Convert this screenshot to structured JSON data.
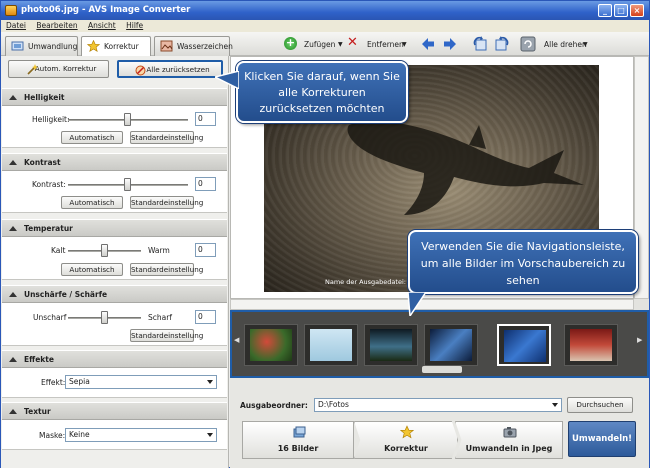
{
  "window": {
    "title": "photo06.jpg - AVS Image Converter"
  },
  "menu": [
    "Datei",
    "Bearbeiten",
    "Ansicht",
    "Hilfe"
  ],
  "tabs": [
    {
      "label": "Umwandlung",
      "active": false
    },
    {
      "label": "Korrektur",
      "active": true
    },
    {
      "label": "Wasserzeichen",
      "active": false
    }
  ],
  "toolbar": {
    "add": "Zufügen",
    "remove": "Entfernen",
    "rotate_all": "Alle drehen"
  },
  "left": {
    "auto_correct": "Autom. Korrektur",
    "reset_all": "Alle zurücksetzen",
    "brightness": {
      "title": "Helligkeit",
      "label": "Helligkeit:",
      "value": "0",
      "slider_fraction": 0.5,
      "auto": "Automatisch",
      "default": "Standardeinstellung"
    },
    "contrast": {
      "title": "Kontrast",
      "label": "Kontrast:",
      "value": "0",
      "slider_fraction": 0.5,
      "auto": "Automatisch",
      "default": "Standardeinstellung"
    },
    "temperature": {
      "title": "Temperatur",
      "left": "Kalt",
      "right": "Warm",
      "value": "0",
      "slider_fraction": 0.5,
      "auto": "Automatisch",
      "default": "Standardeinstellung"
    },
    "sharpness": {
      "title": "Unschärfe / Schärfe",
      "left": "Unscharf",
      "right": "Scharf",
      "value": "0",
      "slider_fraction": 0.5,
      "default": "Standardeinstellung"
    },
    "effects": {
      "title": "Effekte",
      "label": "Effekt:",
      "value": "Sepia"
    },
    "texture": {
      "title": "Textur",
      "label": "Maske:",
      "value": "Keine"
    }
  },
  "preview": {
    "caption": "Name der Ausgabedatei: pho"
  },
  "callouts": {
    "reset": "Klicken Sie darauf, wenn Sie alle Korrekturen zurücksetzen möchten",
    "navigation": "Verwenden Sie die Navigationsleiste, um alle Bilder im Vorschaubereich zu sehen"
  },
  "output": {
    "label": "Ausgabeordner:",
    "path": "D:\\Fotos",
    "browse": "Durchsuchen"
  },
  "steps": {
    "images": "16 Bilder",
    "correction": "Korrektur",
    "convert_to": "Umwandeln in Jpeg",
    "convert_button": "Umwandeln!"
  },
  "colors": {
    "accent_blue": "#2f62c9",
    "callout": "#2f5fa3",
    "strip_border": "#1f5da8"
  }
}
